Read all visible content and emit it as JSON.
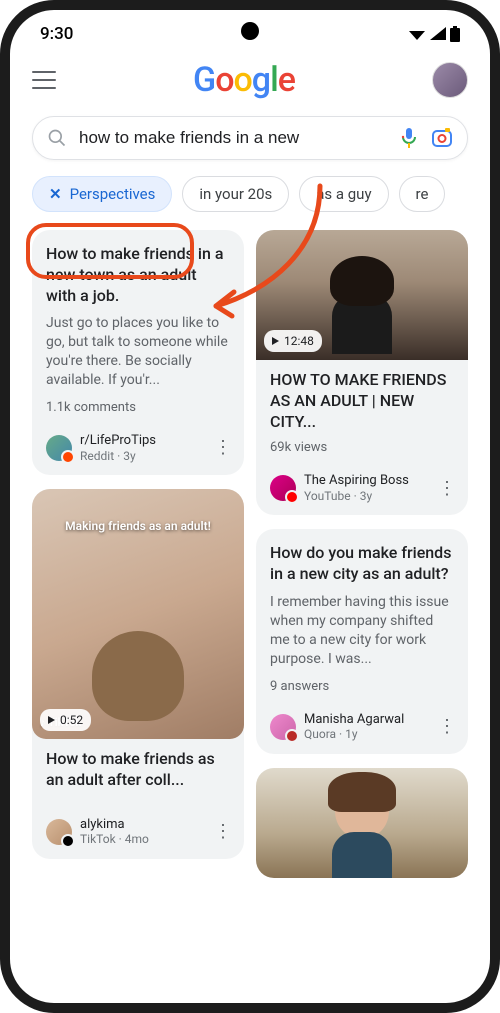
{
  "status": {
    "time": "9:30"
  },
  "header": {
    "logo_letters": [
      "G",
      "o",
      "o",
      "g",
      "l",
      "e"
    ]
  },
  "search": {
    "query": "how to make friends in a new"
  },
  "chips": [
    {
      "label": "Perspectives",
      "active": true,
      "closeable": true
    },
    {
      "label": "in your 20s",
      "active": false
    },
    {
      "label": "as a guy",
      "active": false
    },
    {
      "label": "re",
      "active": false
    }
  ],
  "cards": {
    "left1": {
      "title": "How to make friends in a new town as an adult with a job.",
      "snippet": "Just go to places you like to go, but talk to someone while you're there. Be socially available. If you'r...",
      "meta": "1.1k comments",
      "author": "r/LifeProTips",
      "platform": "Reddit · 3y"
    },
    "left2": {
      "overlay_caption": "Making friends as an adult!",
      "duration": "0:52",
      "title": "How to make friends as an adult after coll...",
      "author": "alykima",
      "platform": "TikTok · 4mo"
    },
    "right1": {
      "duration": "12:48",
      "title": "HOW TO MAKE FRIENDS AS AN ADULT | NEW CITY...",
      "meta": "69k views",
      "author": "The Aspiring Boss",
      "platform": "YouTube · 3y"
    },
    "right2": {
      "title": "How do you make friends in a new city as an adult?",
      "snippet": "I remember having this issue when my company shifted me to a new city for work purpose. I was...",
      "meta": "9 answers",
      "author": "Manisha Agarwal",
      "platform": "Quora · 1y"
    }
  }
}
